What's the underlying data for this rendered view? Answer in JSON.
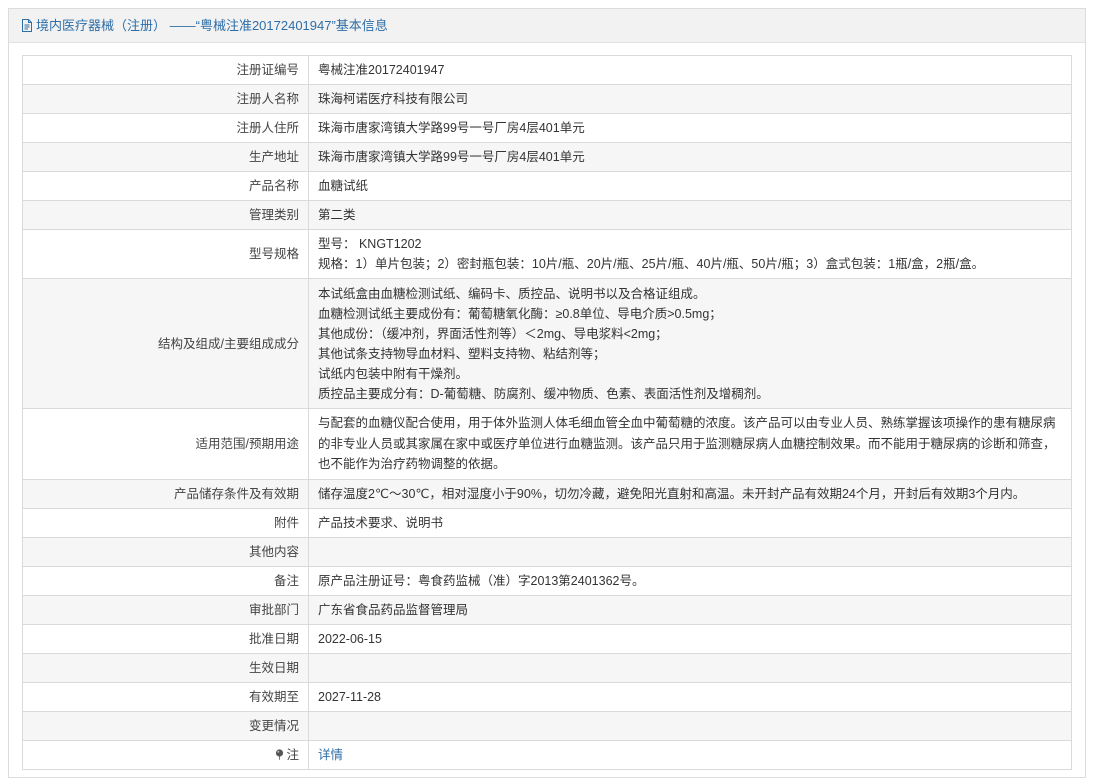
{
  "header": {
    "title": "境内医疗器械（注册） ——“粤械注准20172401947”基本信息"
  },
  "rows": [
    {
      "label": "注册证编号",
      "value": "粤械注准20172401947"
    },
    {
      "label": "注册人名称",
      "value": "珠海柯诺医疗科技有限公司"
    },
    {
      "label": "注册人住所",
      "value": "珠海市唐家湾镇大学路99号一号厂房4层401单元"
    },
    {
      "label": "生产地址",
      "value": "珠海市唐家湾镇大学路99号一号厂房4层401单元"
    },
    {
      "label": "产品名称",
      "value": "血糖试纸"
    },
    {
      "label": "管理类别",
      "value": "第二类"
    },
    {
      "label": "型号规格",
      "lines": [
        "型号： KNGT1202",
        "规格：1）单片包装；2）密封瓶包装：10片/瓶、20片/瓶、25片/瓶、40片/瓶、50片/瓶；3）盒式包装：1瓶/盒，2瓶/盒。"
      ]
    },
    {
      "label": "结构及组成/主要组成成分",
      "lines": [
        "本试纸盒由血糖检测试纸、编码卡、质控品、说明书以及合格证组成。",
        "血糖检测试纸主要成份有：葡萄糖氧化酶：≥0.8单位、导电介质>0.5mg；",
        "其他成份：（缓冲剂，界面活性剂等）＜2mg、导电浆料<2mg；",
        "其他试条支持物导血材料、塑料支持物、粘结剂等；",
        "试纸内包装中附有干燥剂。",
        "质控品主要成分有：D-葡萄糖、防腐剂、缓冲物质、色素、表面活性剂及增稠剂。"
      ]
    },
    {
      "label": "适用范围/预期用途",
      "value": "与配套的血糖仪配合使用，用于体外监测人体毛细血管全血中葡萄糖的浓度。该产品可以由专业人员、熟练掌握该项操作的患有糖尿病的非专业人员或其家属在家中或医疗单位进行血糖监测。该产品只用于监测糖尿病人血糖控制效果。而不能用于糖尿病的诊断和筛查，也不能作为治疗药物调整的依据。"
    },
    {
      "label": "产品储存条件及有效期",
      "value": "储存温度2℃～30℃，相对湿度小于90%，切勿冷藏，避免阳光直射和高温。未开封产品有效期24个月，开封后有效期3个月内。"
    },
    {
      "label": "附件",
      "value": "产品技术要求、说明书"
    },
    {
      "label": "其他内容",
      "value": ""
    },
    {
      "label": "备注",
      "value": "原产品注册证号：粤食药监械（准）字2013第2401362号。"
    },
    {
      "label": "审批部门",
      "value": "广东省食品药品监督管理局"
    },
    {
      "label": "批准日期",
      "value": "2022-06-15"
    },
    {
      "label": "生效日期",
      "value": ""
    },
    {
      "label": "有效期至",
      "value": "2027-11-28"
    },
    {
      "label": "变更情况",
      "value": ""
    },
    {
      "label": "注",
      "value": "详情"
    }
  ],
  "icons": {
    "header_icon": "document-icon",
    "note_icon": "pin-icon"
  },
  "colors": {
    "link": "#2e6ea7",
    "header_bg": "#f2f2f2",
    "alt_row_bg": "#f6f6f6",
    "border": "#dadada"
  }
}
